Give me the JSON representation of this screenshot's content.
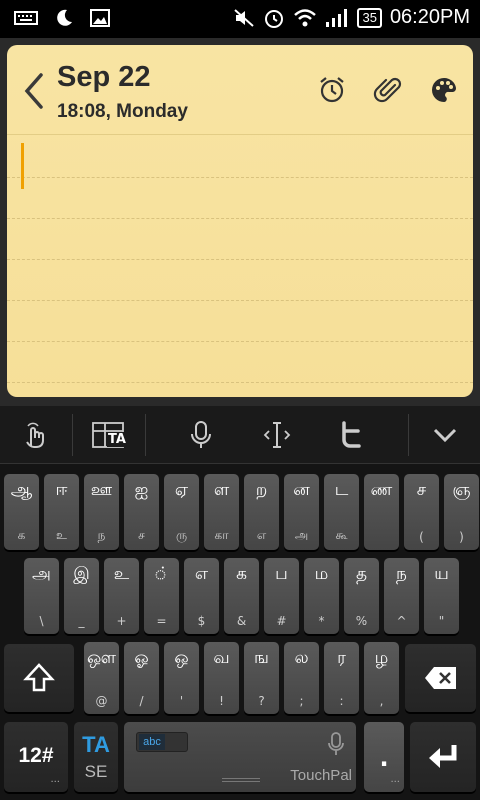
{
  "status_bar": {
    "time": "06:20PM",
    "battery": "35",
    "icons": [
      "keyboard-icon",
      "moon-icon",
      "image-icon",
      "mute-icon",
      "alarm-icon",
      "wifi-icon",
      "signal-icon",
      "battery-icon"
    ]
  },
  "note": {
    "date": "Sep 22",
    "time_line": "18:08, Monday",
    "icons": [
      "back-chevron-icon",
      "alarm-clock-icon",
      "paperclip-icon",
      "palette-icon"
    ],
    "colors": {
      "paper": "#f8e5a5",
      "cursor": "#f0a000"
    }
  },
  "toolbar": {
    "icons": [
      "hand-touch-icon",
      "layout-ta-icon",
      "microphone-icon",
      "text-cursor-icon",
      "twitter-icon",
      "chevron-down-icon"
    ],
    "layout_label": "TA"
  },
  "keyboard": {
    "row1": [
      {
        "main": "ஆ",
        "sub": "க"
      },
      {
        "main": "ஈ",
        "sub": "உ"
      },
      {
        "main": "ஊ",
        "sub": "ந"
      },
      {
        "main": "ஐ",
        "sub": "ச"
      },
      {
        "main": "ஏ",
        "sub": "ரு"
      },
      {
        "main": "ள",
        "sub": "கா"
      },
      {
        "main": "ற",
        "sub": "எ"
      },
      {
        "main": "ன",
        "sub": "அ"
      },
      {
        "main": "ட",
        "sub": "கூ"
      },
      {
        "main": "ண",
        "sub": ""
      },
      {
        "main": "ச",
        "sub": "("
      },
      {
        "main": "ஞ",
        "sub": ")"
      }
    ],
    "row2": [
      {
        "main": "அ",
        "sub": "\\"
      },
      {
        "main": "இ",
        "sub": "_"
      },
      {
        "main": "உ",
        "sub": "+"
      },
      {
        "main": "்",
        "sub": "="
      },
      {
        "main": "எ",
        "sub": "$"
      },
      {
        "main": "க",
        "sub": "&"
      },
      {
        "main": "ப",
        "sub": "#"
      },
      {
        "main": "ம",
        "sub": "*"
      },
      {
        "main": "த",
        "sub": "%"
      },
      {
        "main": "ந",
        "sub": "^"
      },
      {
        "main": "ய",
        "sub": "\""
      }
    ],
    "row3": [
      {
        "main": "ஔ",
        "sub": "@"
      },
      {
        "main": "ஓ",
        "sub": "/"
      },
      {
        "main": "ஒ",
        "sub": "'"
      },
      {
        "main": "வ",
        "sub": "!"
      },
      {
        "main": "ங",
        "sub": "?"
      },
      {
        "main": "ல",
        "sub": ";"
      },
      {
        "main": "ர",
        "sub": ":"
      },
      {
        "main": "ழ",
        "sub": ","
      }
    ],
    "numbers_label": "12#",
    "lang_top": "TA",
    "lang_bottom": "SE",
    "abc_label": "abc",
    "space_label": "TouchPal",
    "period_label": "."
  }
}
